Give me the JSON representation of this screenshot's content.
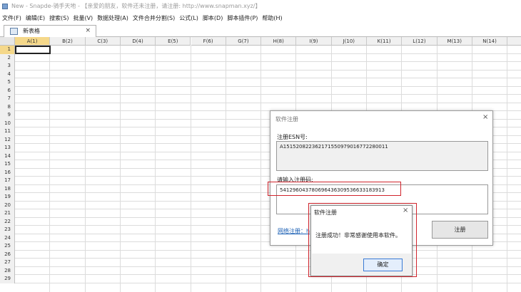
{
  "window": {
    "title": "New - Snapde-骑手天地 - 【亲爱的朋友，软件还未注册，请注册: http://www.snapman.xyz/】"
  },
  "menu": [
    "文件(F)",
    "编辑(E)",
    "搜索(S)",
    "批量(V)",
    "数据处理(A)",
    "文件合并分割(S)",
    "公式(L)",
    "脚本(D)",
    "脚本插件(P)",
    "帮助(H)"
  ],
  "tab": {
    "label": "新表格",
    "close": "×"
  },
  "columns": [
    "A(1)",
    "B(2)",
    "C(3)",
    "D(4)",
    "E(5)",
    "F(6)",
    "G(7)",
    "H(8)",
    "I(9)",
    "J(10)",
    "K(11)",
    "L(12)",
    "M(13)",
    "N(14)",
    "("
  ],
  "rows": [
    "1",
    "2",
    "3",
    "4",
    "5",
    "6",
    "7",
    "8",
    "9",
    "10",
    "11",
    "12",
    "13",
    "14",
    "15",
    "16",
    "17",
    "18",
    "19",
    "20",
    "21",
    "22",
    "23",
    "24",
    "25",
    "26",
    "27",
    "28",
    "29"
  ],
  "selected": {
    "column": "A(1)",
    "row": "1"
  },
  "register_dialog": {
    "title": "软件注册",
    "close": "×",
    "esn_label": "注册ESN号:",
    "esn_value": "A151520822362171550979016772280011",
    "code_label": "请输入注册码:",
    "code_value": "541296043780696436309536633183913",
    "link_text": "网络注册：h",
    "register_button": "注册"
  },
  "success_dialog": {
    "title": "软件注册",
    "close": "×",
    "message": "注册成功！非常感谢使用本软件。",
    "ok_button": "确定"
  },
  "colors": {
    "highlight": "#d0242c",
    "selected_header": "#f5d88a",
    "link": "#1a5fb4"
  }
}
